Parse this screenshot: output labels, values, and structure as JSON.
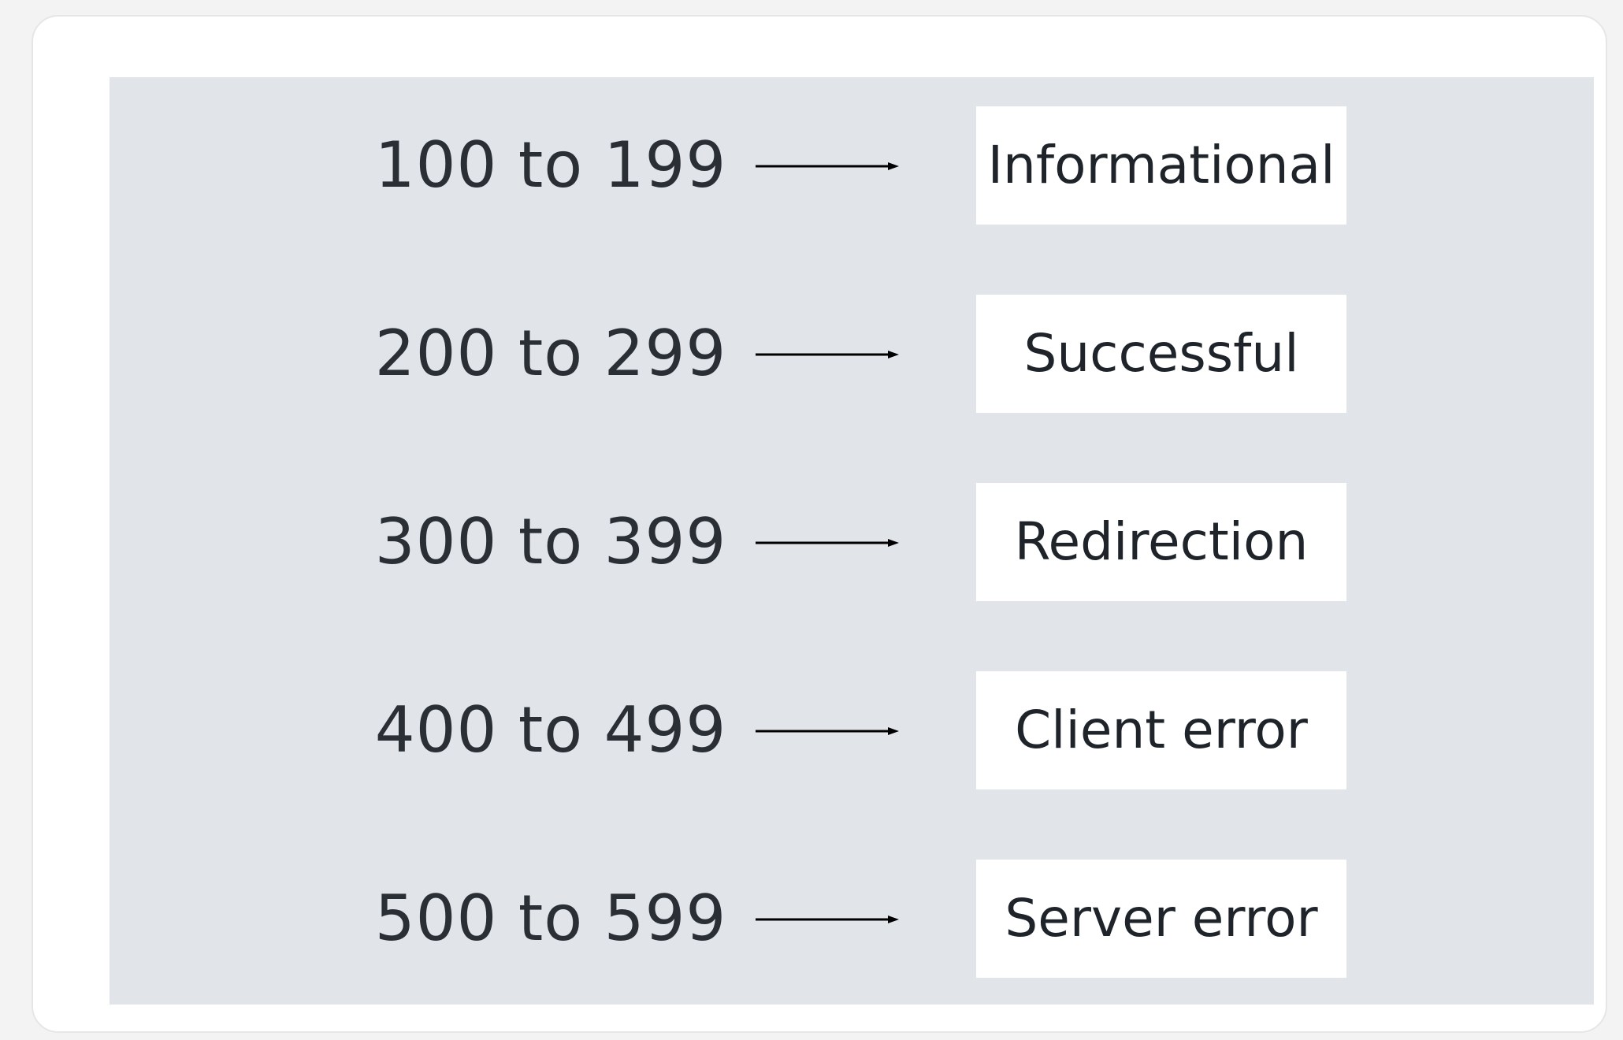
{
  "rows": [
    {
      "range": "100 to 199",
      "category": "Informational"
    },
    {
      "range": "200 to 299",
      "category": "Successful"
    },
    {
      "range": "300 to 399",
      "category": "Redirection"
    },
    {
      "range": "400 to 499",
      "category": "Client error"
    },
    {
      "range": "500 to 599",
      "category": "Server error"
    }
  ],
  "colors": {
    "panel": "#e1e4e9",
    "box": "#ffffff",
    "text": "#2a2f36",
    "arrow": "#000000"
  },
  "icons": {
    "arrow": "right-arrow-icon"
  }
}
